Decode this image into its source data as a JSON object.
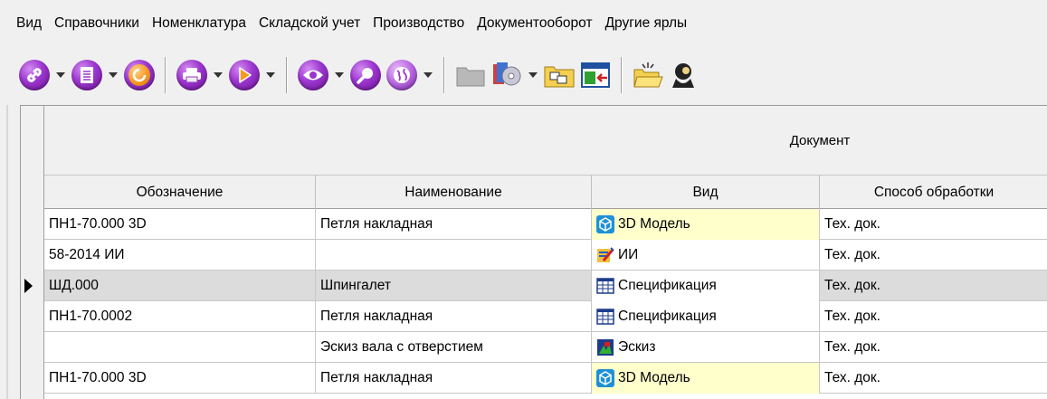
{
  "menu": {
    "items": [
      {
        "label": "Вид"
      },
      {
        "label": "Справочники"
      },
      {
        "label": "Номенклатура"
      },
      {
        "label": "Складской учет"
      },
      {
        "label": "Производство"
      },
      {
        "label": "Документооборот"
      },
      {
        "label": "Другие ярлы"
      }
    ]
  },
  "toolbar": {
    "icons": [
      "link-icon",
      "document-icon",
      "refresh-icon",
      "print-icon",
      "play-icon",
      "view-icon",
      "search-icon",
      "globe-icon",
      "folder-icon",
      "cd-icon",
      "folder-share-icon",
      "window-arrow-icon",
      "open-folder-icon",
      "user-icon"
    ],
    "colors": {
      "purple": "#9b35cf",
      "orange": "#f59a22"
    }
  },
  "grid": {
    "group_header": "Документ",
    "columns": [
      {
        "label": "Обозначение"
      },
      {
        "label": "Наименование"
      },
      {
        "label": "Вид"
      },
      {
        "label": "Способ обработки"
      }
    ],
    "rows": [
      {
        "designation": "ПН1-70.000 3D",
        "name": "Петля накладная",
        "kind": "3D Модель",
        "kind_icon": "cube-icon",
        "method": "Тех. док.",
        "selected": false
      },
      {
        "designation": "58-2014 ИИ",
        "name": "",
        "kind": "ИИ",
        "kind_icon": "edit-icon",
        "method": "Тех. док.",
        "selected": false
      },
      {
        "designation": "ШД.000",
        "name": "Шпингалет",
        "kind": "Спецификация",
        "kind_icon": "table-icon",
        "method": "Тех. док.",
        "selected": true
      },
      {
        "designation": "ПН1-70.0002",
        "name": "Петля накладная",
        "kind": "Спецификация",
        "kind_icon": "table-icon",
        "method": "Тех. док.",
        "selected": false
      },
      {
        "designation": "",
        "name": "Эскиз вала с отверстием",
        "kind": "Эскиз",
        "kind_icon": "sketch-icon",
        "method": "Тех. док.",
        "selected": false
      },
      {
        "designation": "ПН1-70.000 3D",
        "name": "Петля накладная",
        "kind": "3D Модель",
        "kind_icon": "cube-icon",
        "method": "Тех. док.",
        "selected": false
      }
    ]
  }
}
